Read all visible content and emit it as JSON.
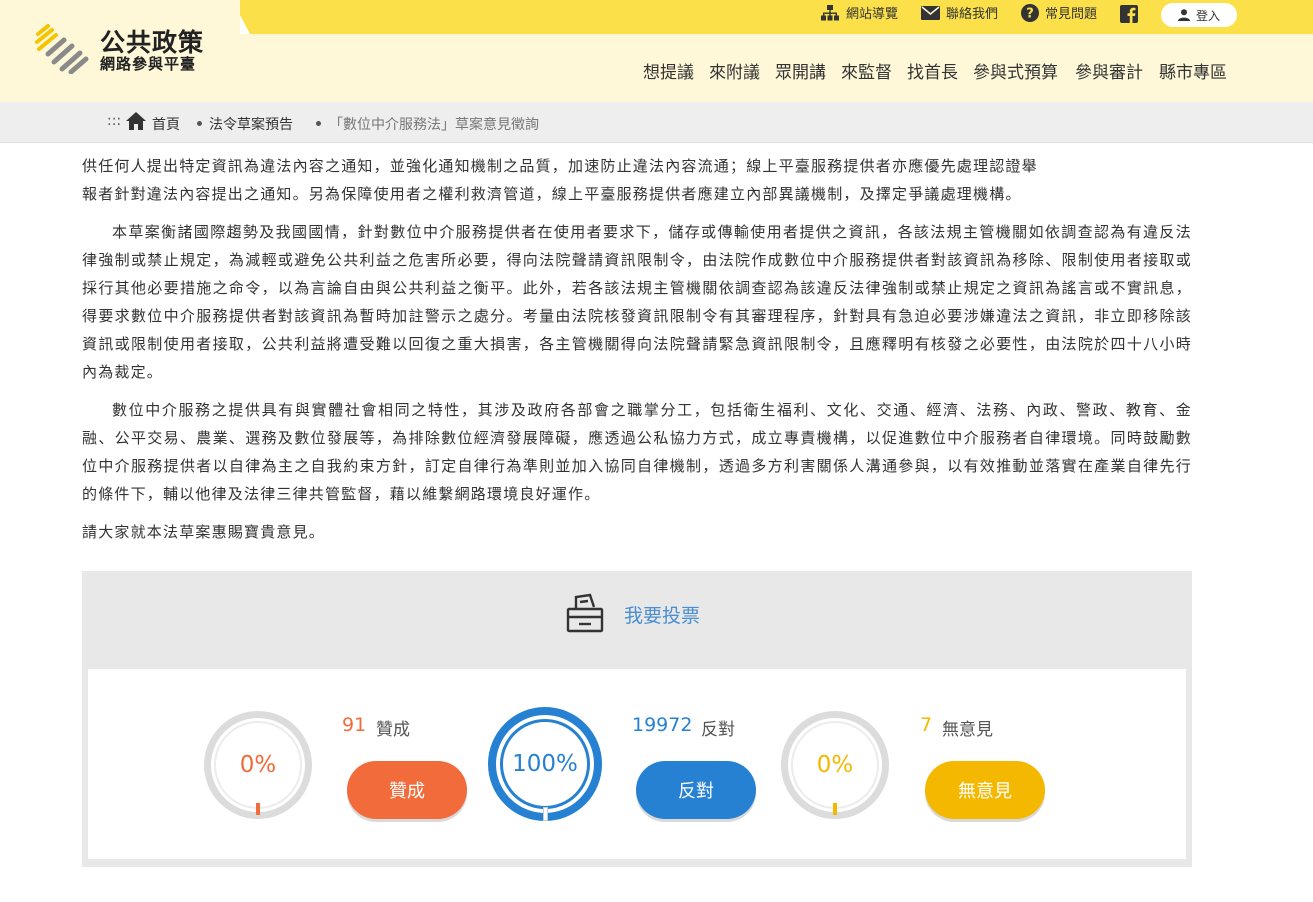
{
  "header": {
    "site_title": "公共政策",
    "site_subtitle": "網路參與平臺",
    "utility": {
      "sitemap": "網站導覽",
      "contact": "聯絡我們",
      "faq": "常見問題",
      "login": "登入"
    },
    "nav": [
      "想提議",
      "來附議",
      "眾開講",
      "來監督",
      "找首長",
      "參與式預算",
      "參與審計",
      "縣市專區"
    ]
  },
  "breadcrumb": {
    "marker": ":::",
    "items": [
      "首頁",
      "法令草案預告",
      "「數位中介服務法」草案意見徵詢"
    ]
  },
  "article": {
    "partial_line": "供任何人提出特定資訊為違法內容之通知，並強化通知機制之品質，加速防止違法內容流通；線上平臺服務提供者亦應優先處理認證舉",
    "partial_line2": "報者針對違法內容提出之通知。另為保障使用者之權利救濟管道，線上平臺服務提供者應建立內部異議機制，及擇定爭議處理機構。",
    "p1": "本草案衡諸國際趨勢及我國國情，針對數位中介服務提供者在使用者要求下，儲存或傳輸使用者提供之資訊，各該法規主管機關如依調查認為有違反法律強制或禁止規定，為減輕或避免公共利益之危害所必要，得向法院聲請資訊限制令，由法院作成數位中介服務提供者對該資訊為移除、限制使用者接取或採行其他必要措施之命令，以為言論自由與公共利益之衡平。此外，若各該法規主管機關依調查認為該違反法律強制或禁止規定之資訊為謠言或不實訊息，得要求數位中介服務提供者對該資訊為暫時加註警示之處分。考量由法院核發資訊限制令有其審理程序，針對具有急迫必要涉嫌違法之資訊，非立即移除該資訊或限制使用者接取，公共利益將遭受難以回復之重大損害，各主管機關得向法院聲請緊急資訊限制令，且應釋明有核發之必要性，由法院於四十八小時內為裁定。",
    "p2": "數位中介服務之提供具有與實體社會相同之特性，其涉及政府各部會之職掌分工，包括衛生福利、文化、交通、經濟、法務、內政、警政、教育、金融、公平交易、農業、選務及數位發展等，為排除數位經濟發展障礙，應透過公私協力方式，成立專責機構，以促進數位中介服務者自律環境。同時鼓勵數位中介服務提供者以自律為主之自我約束方針，訂定自律行為準則並加入協同自律機制，透過多方利害關係人溝通參與，以有效推動並落實在產業自律先行的條件下，輔以他律及法律三律共管監督，藉以維繫網路環境良好運作。",
    "closing": "請大家就本法草案惠賜寶貴意見。"
  },
  "vote": {
    "title": "我要投票",
    "agree": {
      "percent_label": "0%",
      "percent": 0,
      "count": "91",
      "count_label": "贊成",
      "button": "贊成",
      "color": "#f26b3a"
    },
    "oppose": {
      "percent_label": "100%",
      "percent": 100,
      "count": "19972",
      "count_label": "反對",
      "button": "反對",
      "color": "#2781d2"
    },
    "neutral": {
      "percent_label": "0%",
      "percent": 0,
      "count": "7",
      "count_label": "無意見",
      "button": "無意見",
      "color": "#f5b800"
    }
  },
  "colors": {
    "brand_yellow": "#fbe04a",
    "header_bg": "#fef8d8",
    "accent_blue": "#4a8fd0"
  }
}
